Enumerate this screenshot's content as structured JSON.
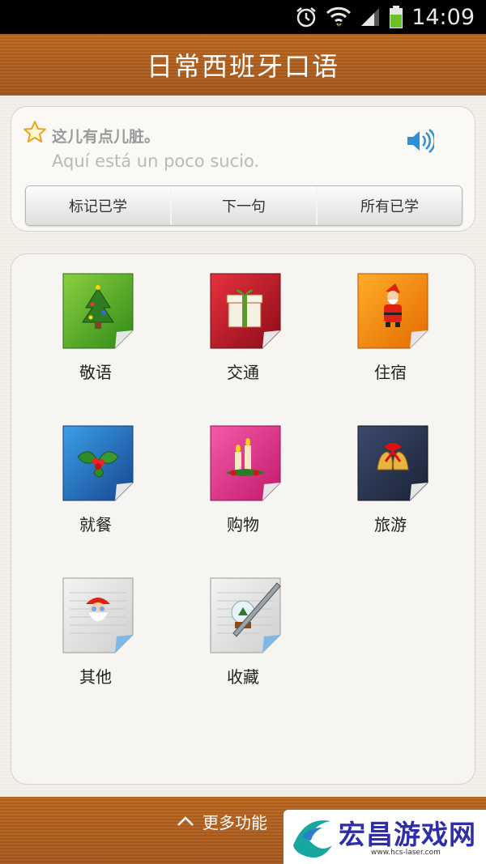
{
  "status_bar": {
    "time": "14:09",
    "icons": [
      "alarm-icon",
      "wifi-icon",
      "signal-icon",
      "battery-icon"
    ]
  },
  "header": {
    "title": "日常西班牙口语"
  },
  "sentence": {
    "chinese": "这儿有点儿脏。",
    "spanish": "Aquí está un poco sucio.",
    "buttons": {
      "mark_learned": "标记已学",
      "next": "下一句",
      "all_learned": "所有已学"
    }
  },
  "categories": [
    {
      "label": "敬语",
      "icon": "christmas-tree-icon",
      "color": "#4caf2a"
    },
    {
      "label": "交通",
      "icon": "gift-box-icon",
      "color": "#c21a2a"
    },
    {
      "label": "住宿",
      "icon": "santa-claus-icon",
      "color": "#f08a10"
    },
    {
      "label": "就餐",
      "icon": "holly-icon",
      "color": "#1f6fb7"
    },
    {
      "label": "购物",
      "icon": "candles-icon",
      "color": "#e0318a"
    },
    {
      "label": "旅游",
      "icon": "bells-icon",
      "color": "#2a3450"
    },
    {
      "label": "其他",
      "icon": "santa-note-icon",
      "color": "#d9d9d9"
    },
    {
      "label": "收藏",
      "icon": "snow-globe-note-icon",
      "color": "#d9d9d9"
    }
  ],
  "footer": {
    "more_label": "更多功能"
  },
  "watermark": {
    "text": "宏昌游戏网",
    "url": "www.hcs-laser.com"
  }
}
